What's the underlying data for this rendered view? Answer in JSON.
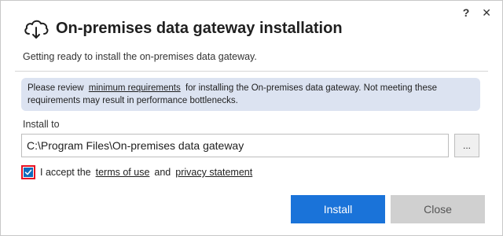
{
  "window": {
    "help_label": "?",
    "close_label": "✕"
  },
  "header": {
    "title": "On-premises data gateway installation",
    "icon": "cloud-download-icon"
  },
  "subtitle": "Getting ready to install the on-premises data gateway.",
  "info": {
    "prefix": "Please review",
    "link": "minimum requirements",
    "suffix": "for installing the On-premises data gateway. Not meeting these requirements may result in performance bottlenecks."
  },
  "install": {
    "label": "Install to",
    "path_value": "C:\\Program Files\\On-premises data gateway",
    "browse_label": "..."
  },
  "accept": {
    "checked": true,
    "text_before": "I accept the",
    "terms_link": "terms of use",
    "text_and": "and",
    "privacy_link": "privacy statement"
  },
  "buttons": {
    "install_label": "Install",
    "close_label": "Close"
  },
  "colors": {
    "accent": "#1a73d9",
    "info_bg": "#dce3f1",
    "focus_outline": "#e81123"
  }
}
